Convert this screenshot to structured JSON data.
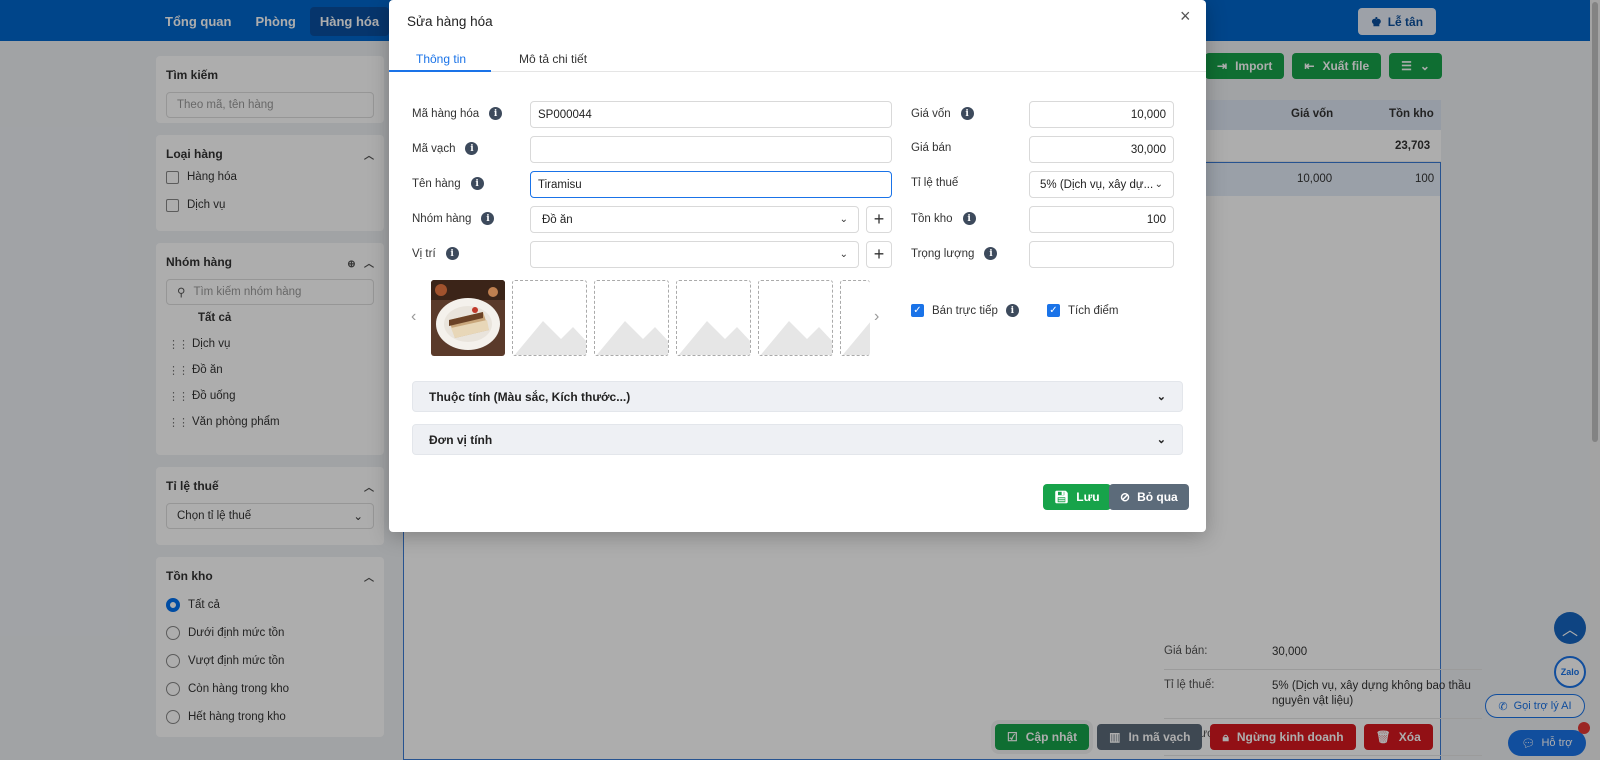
{
  "topnav": {
    "items": [
      "Tổng quan",
      "Phòng",
      "Hàng hóa"
    ],
    "reception_label": "Lễ tân"
  },
  "sidebar": {
    "search": {
      "title": "Tìm kiếm",
      "placeholder": "Theo mã, tên hàng"
    },
    "type": {
      "title": "Loại hàng",
      "items": [
        "Hàng hóa",
        "Dịch vụ"
      ]
    },
    "group": {
      "title": "Nhóm hàng",
      "placeholder": "Tìm kiếm nhóm hàng",
      "all": "Tất cả",
      "items": [
        "Dịch vụ",
        "Đồ ăn",
        "Đồ uống",
        "Văn phòng phẩm"
      ]
    },
    "tax": {
      "title": "Tỉ lệ thuế",
      "placeholder": "Chọn tỉ lệ thuế"
    },
    "stock": {
      "title": "Tồn kho",
      "options": [
        "Tất cả",
        "Dưới định mức tồn",
        "Vượt định mức tồn",
        "Còn hàng trong kho",
        "Hết hàng trong kho"
      ],
      "selected": "Tất cả"
    }
  },
  "toolbar": {
    "import": "Import",
    "export": "Xuất file"
  },
  "table": {
    "headers": {
      "cost": "Giá vốn",
      "stock": "Tồn kho"
    },
    "summary_stock": "23,703",
    "row": {
      "cost": "10,000",
      "stock": "100"
    }
  },
  "detail": [
    {
      "key": "Giá bán:",
      "value": "30,000"
    },
    {
      "key": "Tỉ lệ thuế:",
      "value": "5% (Dịch vụ, xây dựng không bao thầu nguyên vật liệu)"
    },
    {
      "key": "Trọng lượng:",
      "value": ""
    },
    {
      "key": "Vị trí:",
      "value": ""
    }
  ],
  "actions": {
    "update": "Cập nhật",
    "print_barcode": "In mã vạch",
    "stop_selling": "Ngừng kinh doanh",
    "delete": "Xóa"
  },
  "widgets": {
    "ai_call": "Gọi trợ lý AI",
    "help": "Hỗ trợ",
    "zalo": "Zalo"
  },
  "modal": {
    "title": "Sửa hàng hóa",
    "close": "×",
    "tabs": [
      "Thông tin",
      "Mô tả chi tiết"
    ],
    "fields": {
      "code": {
        "label": "Mã hàng hóa",
        "value": "SP000044"
      },
      "barcode": {
        "label": "Mã vạch",
        "value": ""
      },
      "name": {
        "label": "Tên hàng",
        "value": "Tiramisu"
      },
      "group": {
        "label": "Nhóm hàng",
        "value": "Đồ ăn"
      },
      "location": {
        "label": "Vị trí",
        "value": ""
      },
      "cost": {
        "label": "Giá vốn",
        "value": "10,000"
      },
      "price": {
        "label": "Giá bán",
        "value": "30,000"
      },
      "tax": {
        "label": "Tỉ lệ thuế",
        "value": "5% (Dịch vụ, xây dự..."
      },
      "stock": {
        "label": "Tồn kho",
        "value": "100"
      },
      "weight": {
        "label": "Trọng lượng",
        "value": ""
      }
    },
    "checkboxes": [
      {
        "label": "Bán trực tiếp",
        "checked": true
      },
      {
        "label": "Tích điểm",
        "checked": true
      }
    ],
    "accordions": [
      "Thuộc tính (Màu sắc, Kích thước...)",
      "Đơn vị tính"
    ],
    "save": "Lưu",
    "skip": "Bỏ qua"
  },
  "colors": {
    "primary": "#0066cc",
    "accent": "#1a73e8",
    "success": "#17a34a",
    "danger": "#d71920",
    "secondary": "#5c6b7a"
  }
}
